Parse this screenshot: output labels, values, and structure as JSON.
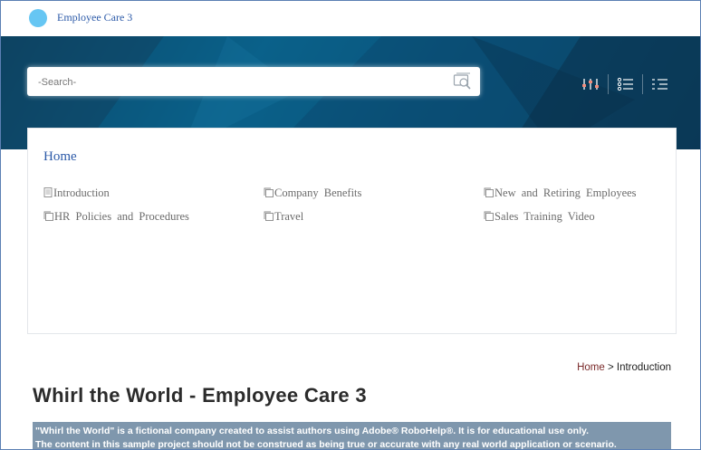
{
  "header": {
    "app_title": "Employee Care 3"
  },
  "search": {
    "placeholder": "-Search-"
  },
  "toolbar": {
    "icons": [
      "filter-sliders-icon",
      "list-icon",
      "toc-list-icon"
    ]
  },
  "toc": {
    "title": "Home",
    "items": [
      {
        "label": "Introduction",
        "icon": "page-icon"
      },
      {
        "label": "Company Benefits",
        "icon": "book-icon"
      },
      {
        "label": "New and Retiring Employees",
        "icon": "book-icon"
      },
      {
        "label": "HR Policies and Procedures",
        "icon": "book-icon"
      },
      {
        "label": "Travel",
        "icon": "book-icon"
      },
      {
        "label": "Sales Training Video",
        "icon": "book-icon"
      }
    ]
  },
  "breadcrumb": {
    "home": "Home",
    "separator": ">",
    "current": "Introduction"
  },
  "content": {
    "title": "Whirl the World - Employee Care 3",
    "notice_line1": "\"Whirl the World\" is a fictional company created to assist authors using Adobe® RoboHelp®. It is for educational use only.",
    "notice_line2": "The content in this sample project should not be construed as being true or accurate with any real world application or scenario."
  },
  "colors": {
    "accent": "#2c5aa8",
    "logo": "#66c6f3",
    "banner": "#0b5c84",
    "notice_bg": "#7f97ad"
  }
}
